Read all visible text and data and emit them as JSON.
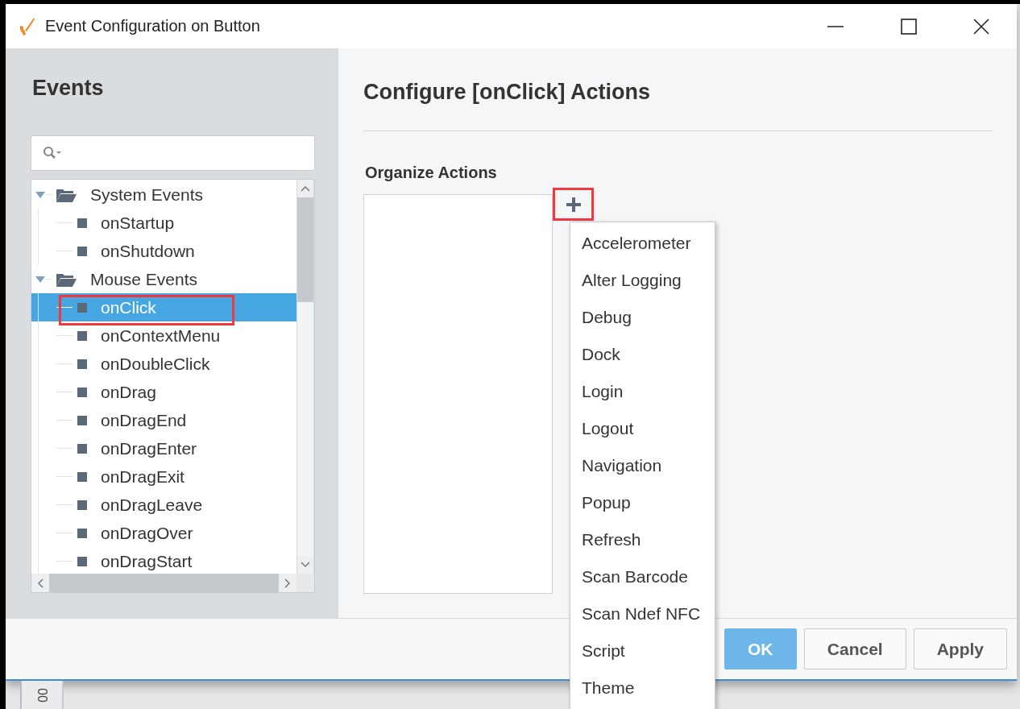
{
  "window": {
    "title": "Event Configuration on Button"
  },
  "events_panel": {
    "title": "Events"
  },
  "tree": [
    {
      "label": "System Events",
      "expanded": true,
      "selected": false,
      "highlighted": false,
      "children": [
        {
          "label": "onStartup",
          "selected": false,
          "highlighted": false
        },
        {
          "label": "onShutdown",
          "selected": false,
          "highlighted": false
        }
      ]
    },
    {
      "label": "Mouse Events",
      "expanded": true,
      "selected": false,
      "highlighted": false,
      "children": [
        {
          "label": "onClick",
          "selected": true,
          "highlighted": true
        },
        {
          "label": "onContextMenu",
          "selected": false,
          "highlighted": false
        },
        {
          "label": "onDoubleClick",
          "selected": false,
          "highlighted": false
        },
        {
          "label": "onDrag",
          "selected": false,
          "highlighted": false
        },
        {
          "label": "onDragEnd",
          "selected": false,
          "highlighted": false
        },
        {
          "label": "onDragEnter",
          "selected": false,
          "highlighted": false
        },
        {
          "label": "onDragExit",
          "selected": false,
          "highlighted": false
        },
        {
          "label": "onDragLeave",
          "selected": false,
          "highlighted": false
        },
        {
          "label": "onDragOver",
          "selected": false,
          "highlighted": false
        },
        {
          "label": "onDragStart",
          "selected": false,
          "highlighted": false
        }
      ]
    }
  ],
  "actions_panel": {
    "title": "Configure [onClick] Actions",
    "organize_label": "Organize Actions",
    "add_button": {
      "highlighted": true
    }
  },
  "menu": [
    "Accelerometer",
    "Alter Logging",
    "Debug",
    "Dock",
    "Login",
    "Logout",
    "Navigation",
    "Popup",
    "Refresh",
    "Scan Barcode",
    "Scan Ndef NFC",
    "Script",
    "Theme"
  ],
  "buttons": [
    {
      "label": "OK",
      "kind": "primary"
    },
    {
      "label": "Cancel",
      "kind": "default"
    },
    {
      "label": "Apply",
      "kind": "default"
    }
  ],
  "background_text": "00"
}
